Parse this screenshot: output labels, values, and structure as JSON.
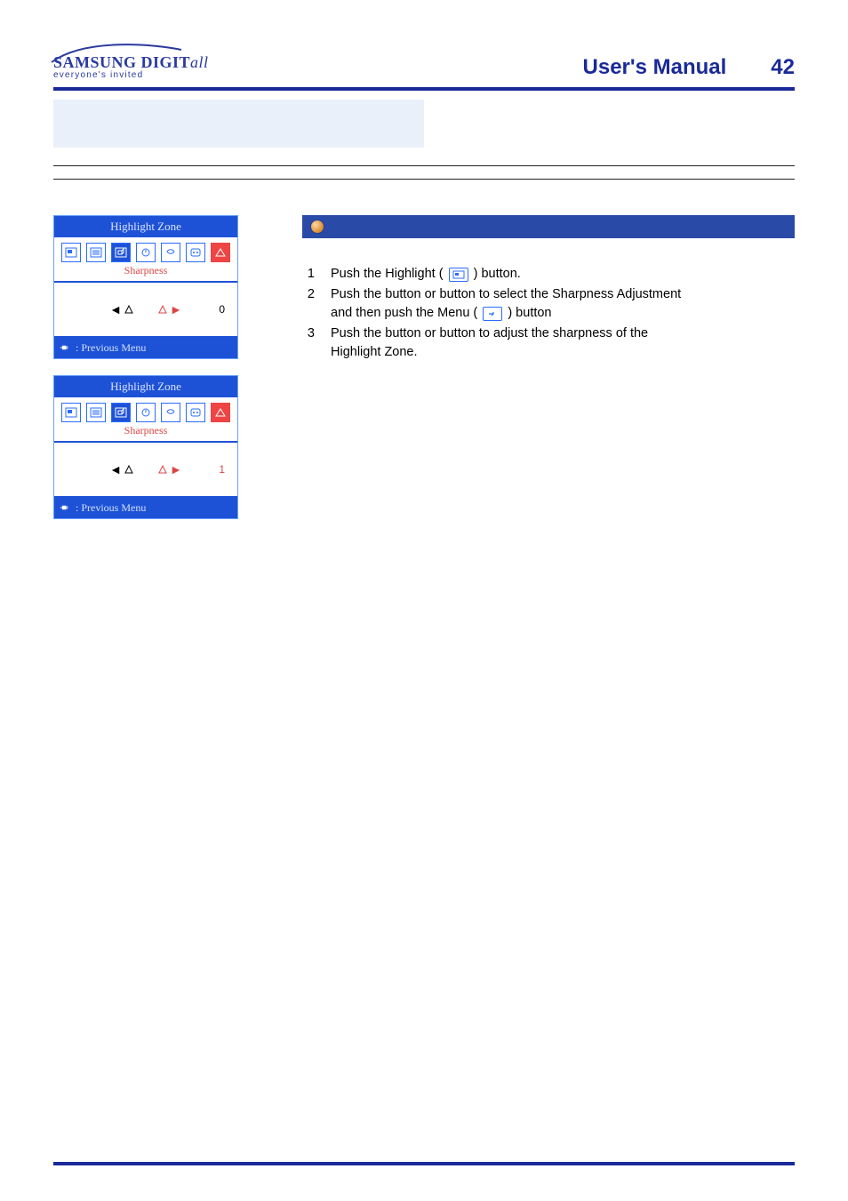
{
  "logo": {
    "brand_main": "SAMSUNG DIGIT",
    "brand_ital": "all",
    "tagline": "everyone's invited"
  },
  "header": {
    "title": "User's Manual",
    "page_number": "42"
  },
  "osd": {
    "title": "Highlight Zone",
    "subtitle": "Sharpness",
    "previous_menu": ": Previous Menu",
    "panel1_value": "0",
    "panel2_value": "1"
  },
  "steps": {
    "s1": {
      "num": "1",
      "before_icon": "Push the Highlight (",
      "after_icon": ") button."
    },
    "s2": {
      "num": "2",
      "line1_a": "Push the ",
      "line1_b": " button or ",
      "line1_c": " button to select the Sharpness Adjustment",
      "line2_a": "and then push the Menu (",
      "line2_b": ") button"
    },
    "s3": {
      "num": "3",
      "line1_a": "Push the ",
      "line1_b": " button or ",
      "line1_c": " button to adjust the sharpness of the",
      "line2": "Highlight Zone."
    }
  }
}
